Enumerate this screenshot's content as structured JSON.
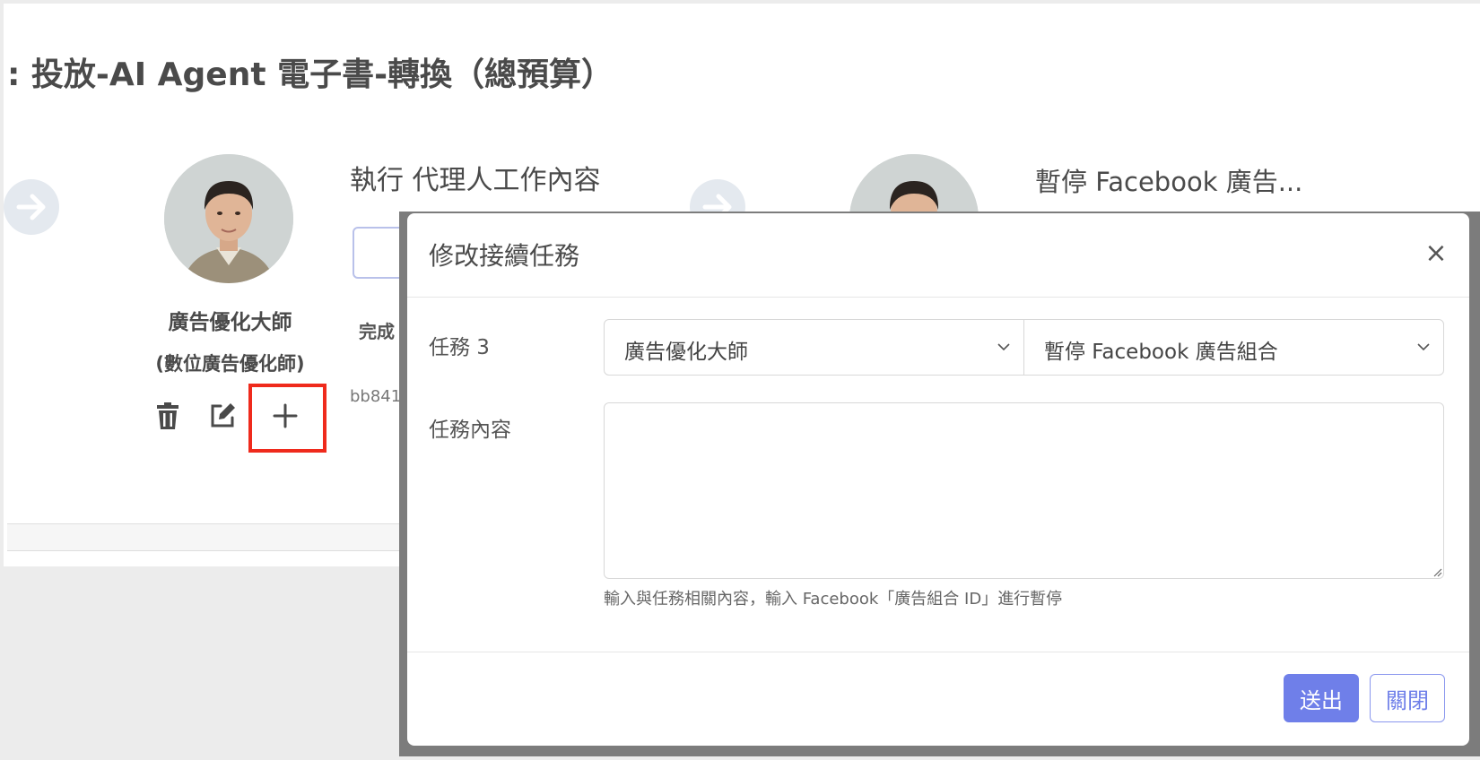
{
  "background": {
    "page_title": ": 投放-AI Agent 電子書-轉換（總預算）",
    "agent": {
      "name": "廣告優化大師",
      "role": "(數位廣告優化師)"
    },
    "steps": [
      {
        "title": "執行 代理人工作內容"
      },
      {
        "title": "暫停 Facebook 廣告..."
      }
    ],
    "partial_texts": {
      "done_label": "完成",
      "id_snippet": "bb841"
    },
    "icons": {
      "arrow": "arrow-right-icon",
      "delete": "trash-icon",
      "edit": "edit-icon",
      "add": "plus-icon"
    },
    "highlight_color": "#ef2a1c"
  },
  "modal": {
    "title": "修改接續任務",
    "close_label": "×",
    "task_label": "任務 3",
    "agent_select_value": "廣告優化大師",
    "task_select_value": "暫停 Facebook 廣告組合",
    "content_label": "任務內容",
    "content_value": "",
    "help_text": "輸入與任務相關內容，輸入 Facebook「廣告組合 ID」進行暫停",
    "submit_label": "送出",
    "close_button_label": "關閉",
    "accent_color": "#6f7fe9"
  }
}
